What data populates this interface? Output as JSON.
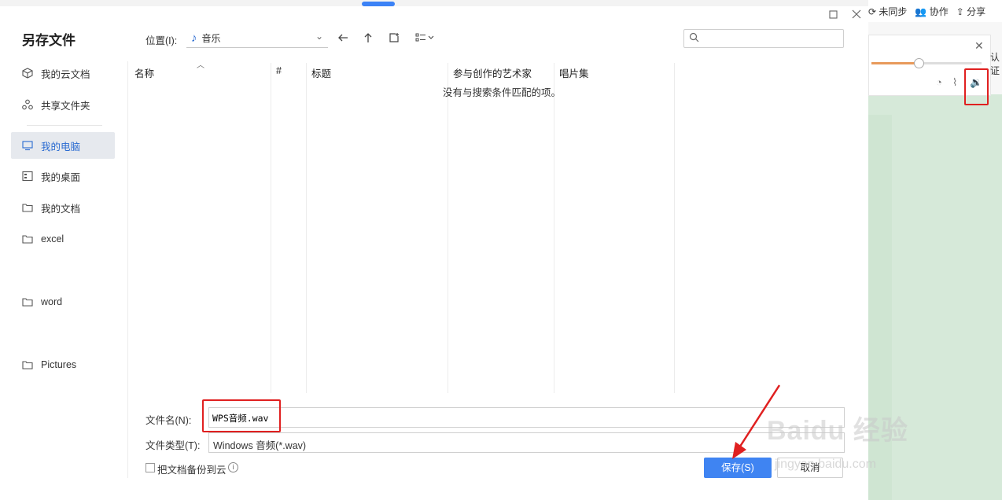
{
  "background_app": {
    "toolbar": {
      "sync_label": "未同步",
      "collab_label": "协作",
      "share_label": "分享",
      "edge_text": "认证"
    }
  },
  "dialog": {
    "title": "另存文件",
    "sidebar": {
      "items": [
        {
          "label": "我的云文档",
          "icon": "cloud-doc-icon"
        },
        {
          "label": "共享文件夹",
          "icon": "share-folder-icon"
        },
        {
          "label": "我的电脑",
          "icon": "computer-icon",
          "active": true
        },
        {
          "label": "我的桌面",
          "icon": "desktop-icon"
        },
        {
          "label": "我的文档",
          "icon": "folder-icon"
        },
        {
          "label": "excel",
          "icon": "folder-icon"
        },
        {
          "label": "word",
          "icon": "folder-icon"
        },
        {
          "label": "Pictures",
          "icon": "folder-icon"
        }
      ]
    },
    "location": {
      "label": "位置(I):",
      "value": "音乐"
    },
    "search": {
      "placeholder": ""
    },
    "columns": [
      "名称",
      "#",
      "标题",
      "参与创作的艺术家",
      "唱片集"
    ],
    "empty_message": "没有与搜索条件匹配的项。",
    "filename": {
      "label": "文件名(N):",
      "value": "WPS音频.wav"
    },
    "filetype": {
      "label": "文件类型(T):",
      "value": "Windows 音频(*.wav)"
    },
    "backup_checkbox": {
      "label": "把文档备份到云",
      "checked": false
    },
    "buttons": {
      "save": "保存(S)",
      "cancel": "取消"
    }
  },
  "watermark": {
    "brand": "Baidu 经验",
    "url": "jingyan.baidu.com"
  },
  "colors": {
    "accent": "#3f84f2",
    "highlight": "#e02020",
    "doc_bg": "#d6e9d9"
  }
}
